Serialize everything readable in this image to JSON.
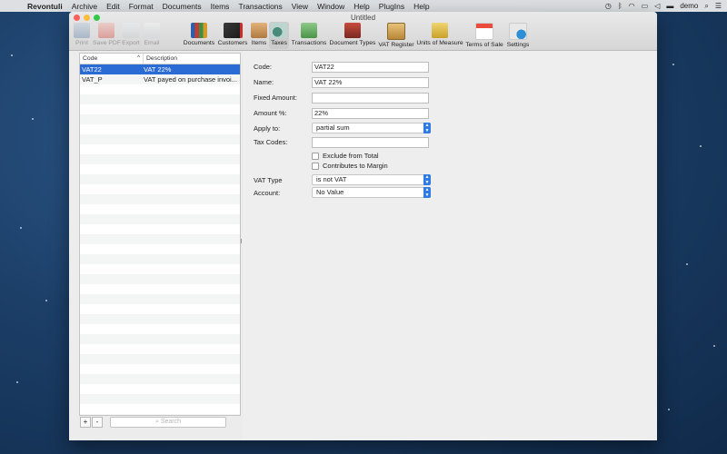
{
  "menubar": {
    "app": "Revontuli",
    "items": [
      "Archive",
      "Edit",
      "Format",
      "Documents",
      "Items",
      "Transactions",
      "View",
      "Window",
      "Help",
      "PlugIns",
      "Help"
    ],
    "user": "demo"
  },
  "window": {
    "title": "Untitled",
    "toolbar": [
      {
        "label": "Print",
        "icon": "printer-icon",
        "enabled": false
      },
      {
        "label": "Save PDF",
        "icon": "pdf-icon",
        "enabled": false
      },
      {
        "label": "Export",
        "icon": "export-icon",
        "enabled": false
      },
      {
        "label": "Email",
        "icon": "paper-plane-icon",
        "enabled": false
      },
      {
        "label": "Documents",
        "icon": "binders-icon",
        "enabled": true
      },
      {
        "label": "Customers",
        "icon": "address-book-icon",
        "enabled": true
      },
      {
        "label": "Items",
        "icon": "boxes-icon",
        "enabled": true
      },
      {
        "label": "Taxes",
        "icon": "scale-hand-icon",
        "enabled": true,
        "active": true
      },
      {
        "label": "Transactions",
        "icon": "money-icon",
        "enabled": true
      },
      {
        "label": "Document Types",
        "icon": "stamp-icon",
        "enabled": true
      },
      {
        "label": "VAT Register",
        "icon": "clipboard-icon",
        "enabled": true
      },
      {
        "label": "Units of Measure",
        "icon": "balance-icon",
        "enabled": true
      },
      {
        "label": "Terms of Sale",
        "icon": "calendar-icon",
        "enabled": true
      },
      {
        "label": "Settings",
        "icon": "gear-badge-icon",
        "enabled": true
      }
    ]
  },
  "list": {
    "columns": {
      "code": "Code",
      "description": "Description"
    },
    "rows": [
      {
        "code": "VAT22",
        "description": "VAT 22%",
        "selected": true
      },
      {
        "code": "VAT_P",
        "description": "VAT payed on purchase invoi...",
        "selected": false
      }
    ],
    "add_label": "+",
    "remove_label": "-",
    "search_placeholder": "Search"
  },
  "form": {
    "code": {
      "label": "Code:",
      "value": "VAT22"
    },
    "name": {
      "label": "Name:",
      "value": "VAT 22%"
    },
    "fixed_amount": {
      "label": "Fixed Amount:",
      "value": ""
    },
    "amount_pct": {
      "label": "Amount %:",
      "value": "22%"
    },
    "apply_to": {
      "label": "Apply to:",
      "value": "partial sum"
    },
    "tax_codes": {
      "label": "Tax Codes:",
      "value": ""
    },
    "exclude_from_total": {
      "label": "Exclude from Total",
      "checked": false
    },
    "contributes_to_margin": {
      "label": "Contributes to Margin",
      "checked": false
    },
    "vat_type": {
      "label": "VAT Type",
      "value": "is not VAT"
    },
    "account": {
      "label": "Account:",
      "value": "No Value"
    }
  },
  "colors": {
    "selection": "#2a6bd4",
    "stepper": "#2f7ae5",
    "close": "#fc605c",
    "minimize": "#fdbc40",
    "zoom": "#34c84a"
  }
}
